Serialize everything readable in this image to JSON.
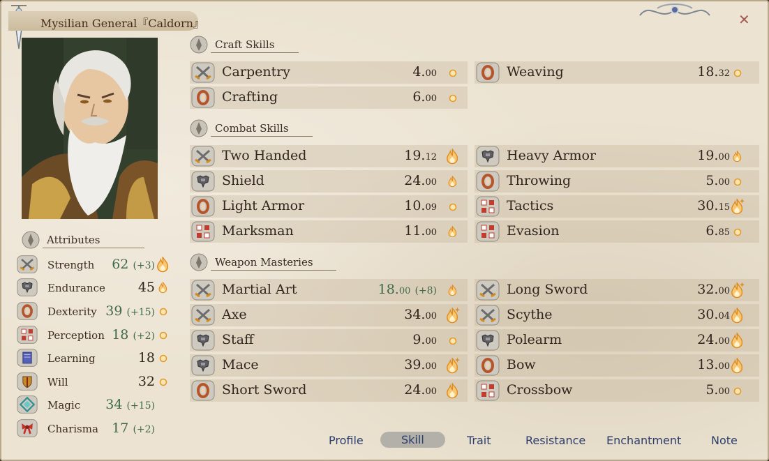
{
  "title": "Mysilian General『Caldorn』",
  "attributes_header": "Attributes",
  "attributes": [
    {
      "name": "Strength",
      "value": "62",
      "bonus": "(+3)",
      "icon": "crossed-swords-icon",
      "potential": "high"
    },
    {
      "name": "Endurance",
      "value": "45",
      "bonus": "",
      "icon": "armor-icon",
      "potential": "medium"
    },
    {
      "name": "Dexterity",
      "value": "39",
      "bonus": "(+15)",
      "icon": "ring-icon",
      "potential": "low"
    },
    {
      "name": "Perception",
      "value": "18",
      "bonus": "(+2)",
      "icon": "dots-icon",
      "potential": "low"
    },
    {
      "name": "Learning",
      "value": "18",
      "bonus": "",
      "icon": "book-icon",
      "potential": "low"
    },
    {
      "name": "Will",
      "value": "32",
      "bonus": "",
      "icon": "shield-emblem-icon",
      "potential": "low"
    },
    {
      "name": "Magic",
      "value": "34",
      "bonus": "(+15)",
      "icon": "rune-icon",
      "potential": ""
    },
    {
      "name": "Charisma",
      "value": "17",
      "bonus": "(+2)",
      "icon": "ribbon-icon",
      "potential": ""
    }
  ],
  "sections": {
    "craft": {
      "label": "Craft Skills"
    },
    "combat": {
      "label": "Combat Skills"
    },
    "weapon": {
      "label": "Weapon Masteries"
    }
  },
  "craft_skills": [
    {
      "name": "Carpentry",
      "int": "4.",
      "dec": "00",
      "bonus": "",
      "icon": "crossed-swords-icon",
      "potential": "low"
    },
    {
      "name": "Weaving",
      "int": "18.",
      "dec": "32",
      "bonus": "",
      "icon": "ring-icon",
      "potential": "low"
    },
    {
      "name": "Crafting",
      "int": "6.",
      "dec": "00",
      "bonus": "",
      "icon": "ring-icon",
      "potential": "low"
    }
  ],
  "combat_skills": [
    {
      "name": "Two Handed",
      "int": "19.",
      "dec": "12",
      "bonus": "",
      "icon": "crossed-swords-icon",
      "potential": "high"
    },
    {
      "name": "Heavy Armor",
      "int": "19.",
      "dec": "00",
      "bonus": "",
      "icon": "armor-icon",
      "potential": "medium"
    },
    {
      "name": "Shield",
      "int": "24.",
      "dec": "00",
      "bonus": "",
      "icon": "armor-icon",
      "potential": "medium"
    },
    {
      "name": "Throwing",
      "int": "5.",
      "dec": "00",
      "bonus": "",
      "icon": "ring-icon",
      "potential": "low"
    },
    {
      "name": "Light Armor",
      "int": "10.",
      "dec": "09",
      "bonus": "",
      "icon": "ring-icon",
      "potential": "low"
    },
    {
      "name": "Tactics",
      "int": "30.",
      "dec": "15",
      "bonus": "",
      "icon": "dots-icon",
      "potential": "superb"
    },
    {
      "name": "Marksman",
      "int": "11.",
      "dec": "00",
      "bonus": "",
      "icon": "dots-icon",
      "potential": "medium"
    },
    {
      "name": "Evasion",
      "int": "6.",
      "dec": "85",
      "bonus": "",
      "icon": "dots-icon",
      "potential": "low"
    }
  ],
  "weapon_skills": [
    {
      "name": "Martial Art",
      "int": "18.",
      "dec": "00",
      "bonus": "(+8)",
      "icon": "crossed-swords-icon",
      "potential": "medium"
    },
    {
      "name": "Long Sword",
      "int": "32.",
      "dec": "00",
      "bonus": "",
      "icon": "crossed-swords-icon",
      "potential": "superb"
    },
    {
      "name": "Axe",
      "int": "34.",
      "dec": "00",
      "bonus": "",
      "icon": "crossed-swords-icon",
      "potential": "superb"
    },
    {
      "name": "Scythe",
      "int": "30.",
      "dec": "04",
      "bonus": "",
      "icon": "crossed-swords-icon",
      "potential": "high"
    },
    {
      "name": "Staff",
      "int": "9.",
      "dec": "00",
      "bonus": "",
      "icon": "armor-icon",
      "potential": "low"
    },
    {
      "name": "Polearm",
      "int": "24.",
      "dec": "00",
      "bonus": "",
      "icon": "armor-icon",
      "potential": "high"
    },
    {
      "name": "Mace",
      "int": "39.",
      "dec": "00",
      "bonus": "",
      "icon": "armor-icon",
      "potential": "superb"
    },
    {
      "name": "Bow",
      "int": "13.",
      "dec": "00",
      "bonus": "",
      "icon": "ring-icon",
      "potential": "high"
    },
    {
      "name": "Short Sword",
      "int": "24.",
      "dec": "00",
      "bonus": "",
      "icon": "ring-icon",
      "potential": "high"
    },
    {
      "name": "Crossbow",
      "int": "5.",
      "dec": "00",
      "bonus": "",
      "icon": "dots-icon",
      "potential": "low"
    }
  ],
  "tabs": [
    "Profile",
    "Skill",
    "Trait",
    "Resistance",
    "Enchantment",
    "Note"
  ],
  "active_tab": "Skill",
  "close_glyph": "✕",
  "colors": {
    "bonus": "#3e6a4a",
    "text": "#2f251e",
    "tab": "#2b3d6b",
    "flame": "#f0a030",
    "panel": "#ece3d2"
  }
}
